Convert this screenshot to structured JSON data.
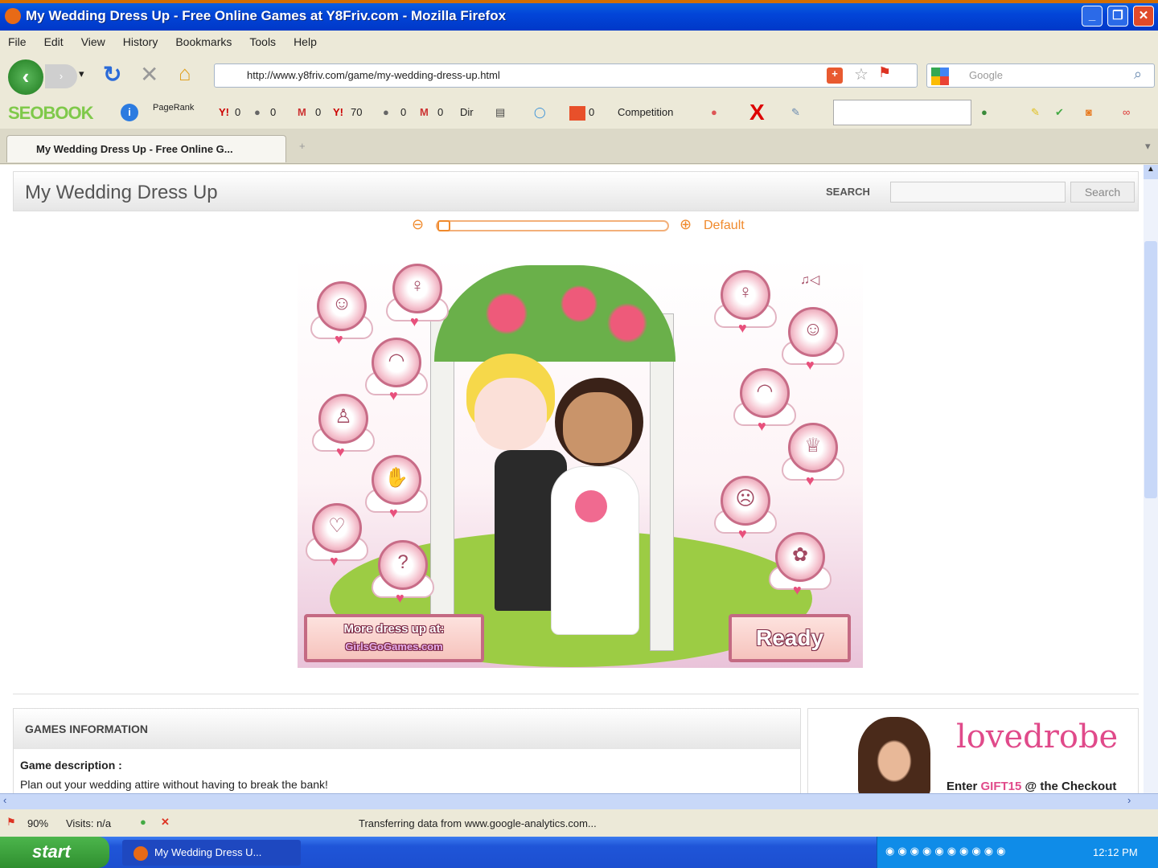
{
  "window": {
    "title": "My Wedding Dress Up - Free Online Games at Y8Friv.com - Mozilla Firefox"
  },
  "menu": [
    "File",
    "Edit",
    "View",
    "History",
    "Bookmarks",
    "Tools",
    "Help"
  ],
  "nav": {
    "url": "http://www.y8friv.com/game/my-wedding-dress-up.html",
    "search_placeholder": "Google"
  },
  "seobar": {
    "brand": "SEOBOOK",
    "pagerank": "PageRank",
    "v1": "0",
    "v2": "0",
    "v3": "0",
    "v4": "70",
    "v5": "0",
    "v6": "0",
    "dir": "Dir",
    "v7": "0",
    "competition": "Competition"
  },
  "tab": {
    "label": "My Wedding Dress Up - Free Online G..."
  },
  "page": {
    "title": "My Wedding Dress Up",
    "search_label": "SEARCH",
    "search_button": "Search",
    "zoom_default": "Default",
    "game": {
      "more_line1": "More dress up at:",
      "more_line2": "GirlsGoGames.com",
      "ready": "Ready"
    },
    "info_header": "GAMES INFORMATION",
    "desc_label": "Game description :",
    "desc_text": "Plan out your wedding attire without having to break the bank!",
    "ad": {
      "brand": "lovedrobe",
      "line_pre": "Enter ",
      "code": "GIFT15",
      "line_post": " @ the Checkout"
    }
  },
  "status": {
    "zoom": "90%",
    "visits": "Visits: n/a",
    "message": "Transferring data from www.google-analytics.com..."
  },
  "taskbar": {
    "start": "start",
    "task": "My Wedding Dress U...",
    "clock": "12:12 PM"
  },
  "colors": {
    "titlebar": "#0245d8",
    "accent_orange": "#f08a2c",
    "pink": "#c86c87",
    "lawn": "#9ccc44"
  }
}
